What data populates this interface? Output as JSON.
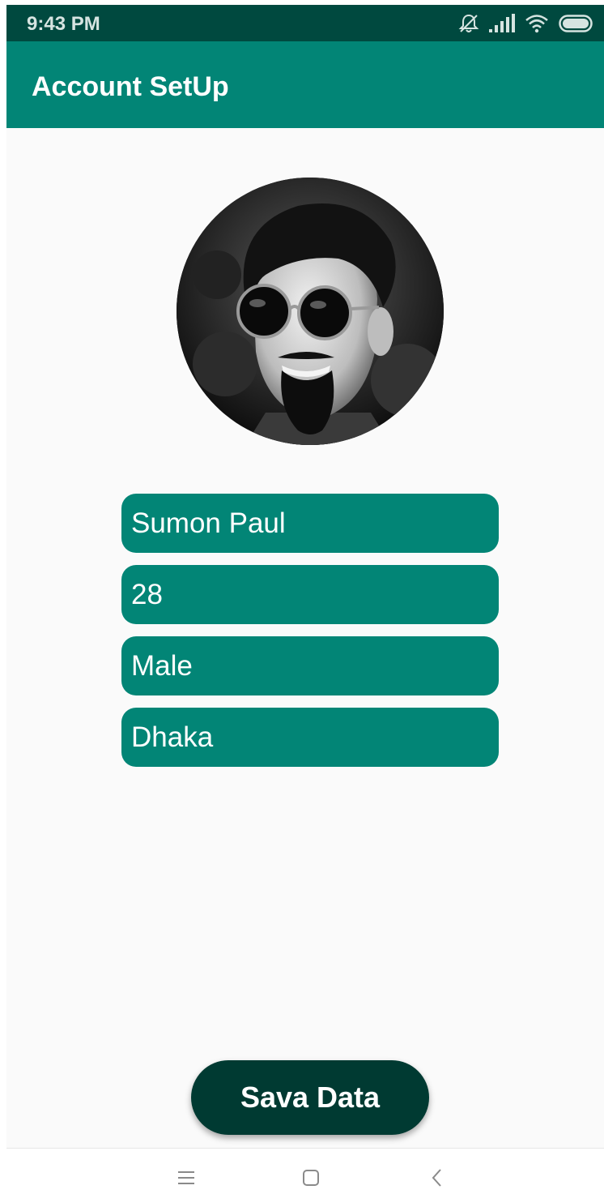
{
  "status_bar": {
    "time": "9:43 PM",
    "icons": [
      "notifications-off-icon",
      "signal-icon",
      "wifi-icon",
      "battery-icon"
    ]
  },
  "app_bar": {
    "title": "Account SetUp"
  },
  "profile": {
    "avatar_icon": "profile-photo"
  },
  "form": {
    "name": "Sumon Paul",
    "age": "28",
    "gender": "Male",
    "city": "Dhaka"
  },
  "actions": {
    "save_label": "Sava Data"
  },
  "nav_bar": {
    "icons": [
      "menu-icon",
      "home-icon",
      "back-icon"
    ]
  },
  "colors": {
    "status_bar": "#00493f",
    "app_bar": "#028576",
    "field": "#028576",
    "button": "#003a32",
    "background": "#fafafa"
  }
}
